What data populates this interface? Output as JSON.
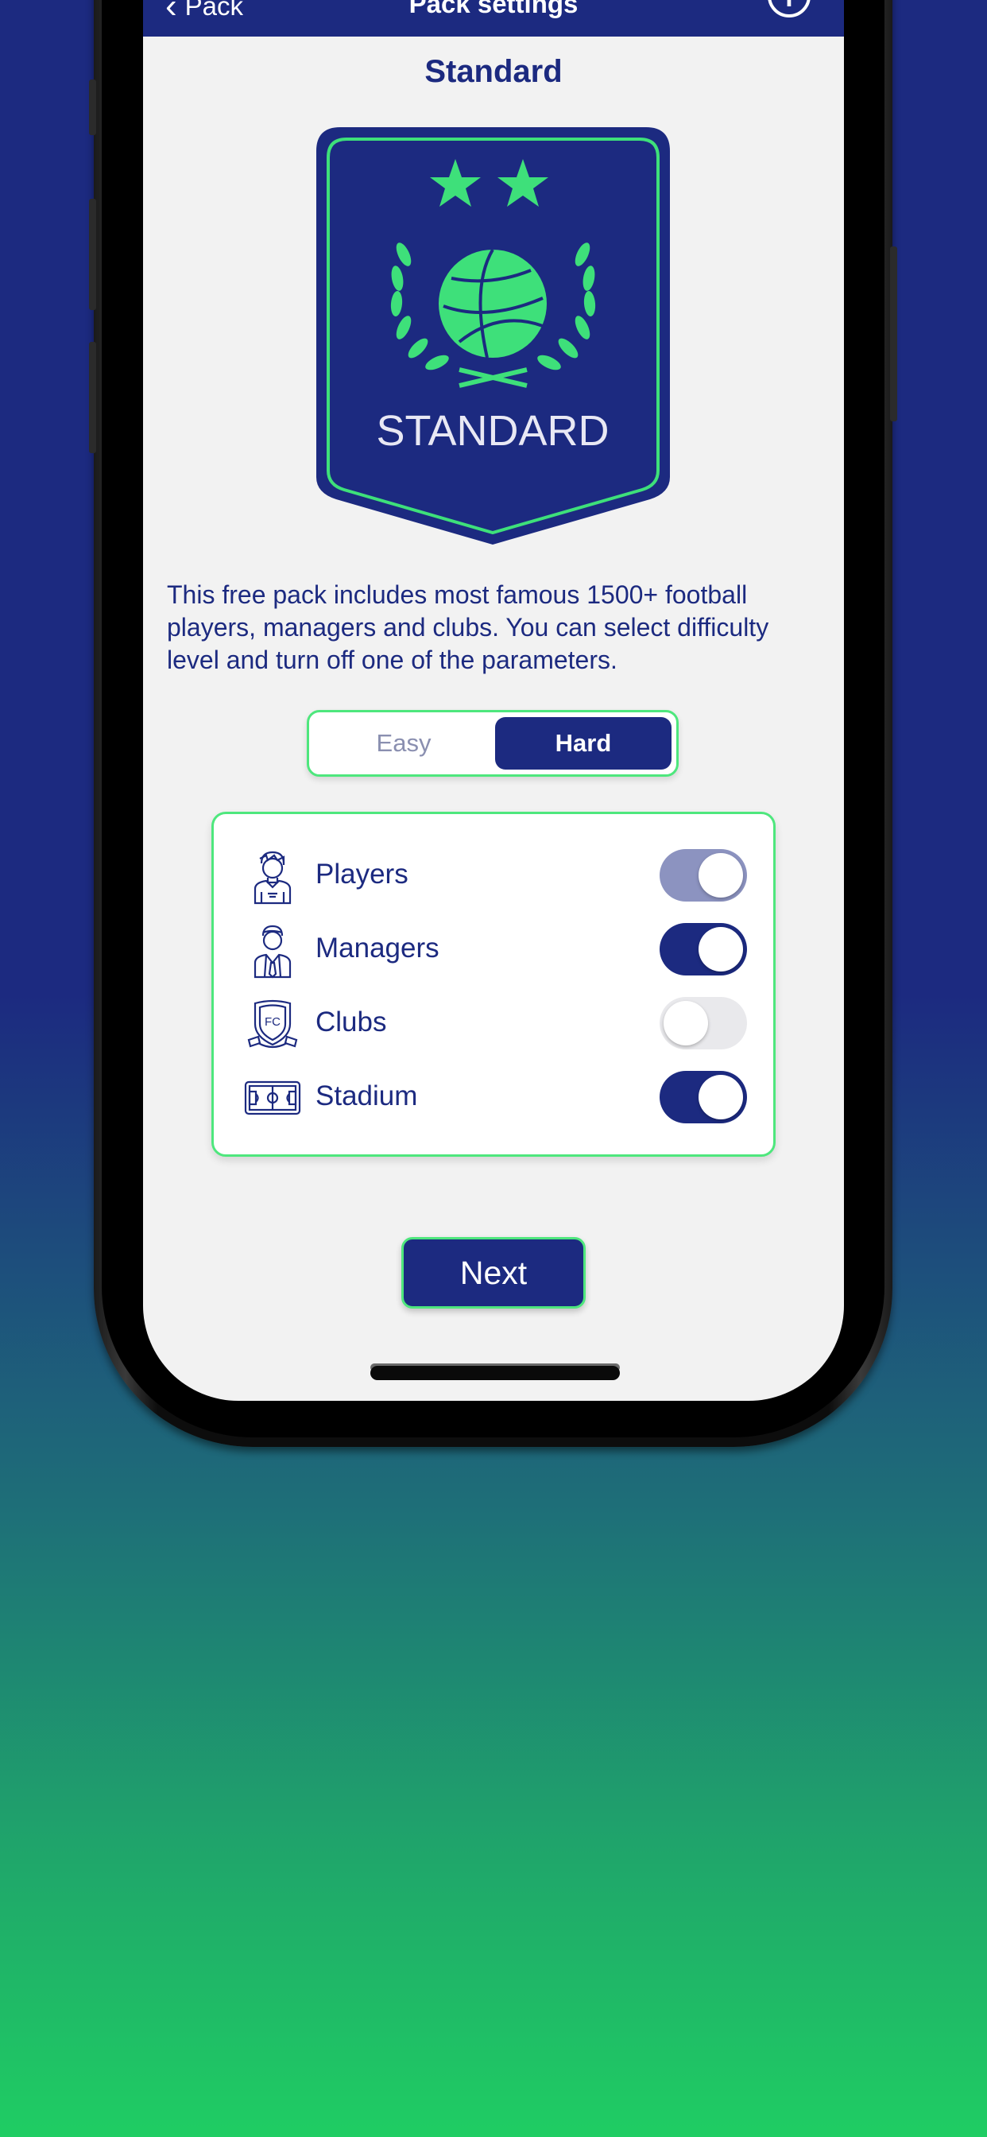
{
  "nav": {
    "back_label": "Pack",
    "title": "Pack settings",
    "info_label": "i"
  },
  "pack": {
    "title": "Standard",
    "badge_text": "STANDARD",
    "description": "This free pack includes most famous 1500+ football players, managers and clubs. You can select difficulty level and turn off one of the parameters."
  },
  "difficulty": {
    "options": [
      "Easy",
      "Hard"
    ],
    "selected": "Hard"
  },
  "parameters": [
    {
      "label": "Players",
      "icon": "player-icon",
      "enabled": true,
      "state": "on-disabled"
    },
    {
      "label": "Managers",
      "icon": "manager-icon",
      "enabled": true,
      "state": "on"
    },
    {
      "label": "Clubs",
      "icon": "club-crest-icon",
      "enabled": false,
      "state": "off"
    },
    {
      "label": "Stadium",
      "icon": "stadium-icon",
      "enabled": true,
      "state": "on"
    }
  ],
  "next_label": "Next",
  "colors": {
    "primary": "#1c2a80",
    "accent": "#4ee77d",
    "background": "#f2f2f2"
  }
}
